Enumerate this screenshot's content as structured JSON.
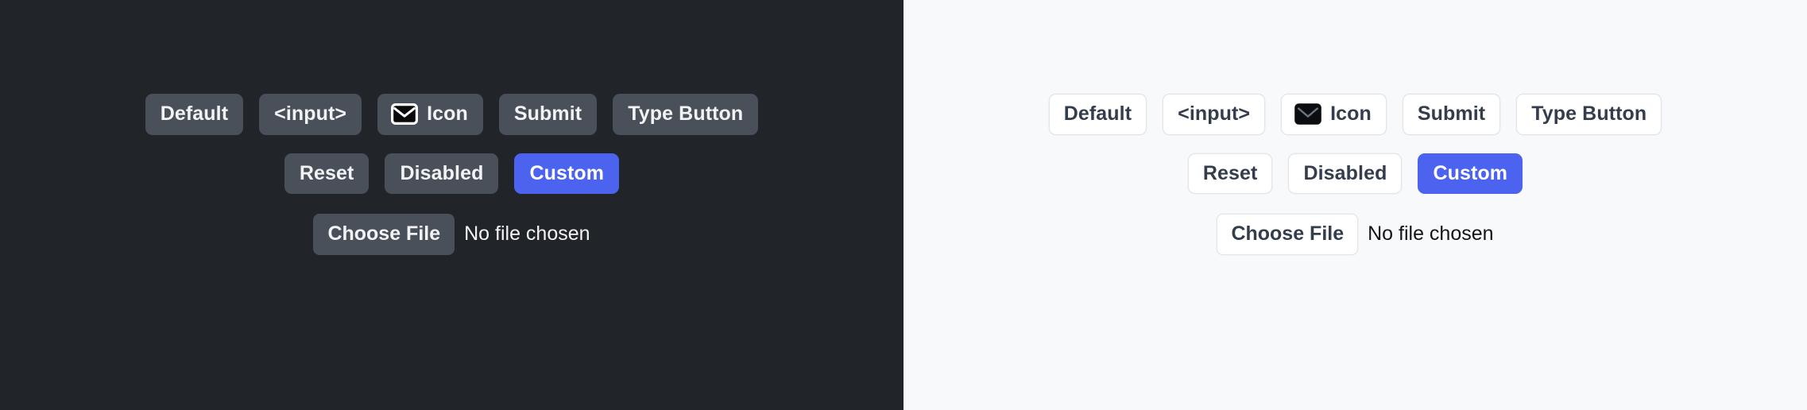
{
  "panels": [
    {
      "theme": "dark",
      "background": "#212428",
      "button_bg": "#4a505a",
      "button_text": "#f1f3f5",
      "accent": "#4c63f0",
      "rows": {
        "row1": [
          {
            "label": "Default",
            "name": "default-button"
          },
          {
            "label": "<input>",
            "name": "input-button"
          },
          {
            "label": "Icon",
            "name": "icon-button",
            "icon": "envelope-icon"
          },
          {
            "label": "Submit",
            "name": "submit-button"
          },
          {
            "label": "Type Button",
            "name": "type-button"
          }
        ],
        "row2": [
          {
            "label": "Reset",
            "name": "reset-button"
          },
          {
            "label": "Disabled",
            "name": "disabled-button"
          },
          {
            "label": "Custom",
            "name": "custom-button",
            "variant": "custom"
          }
        ],
        "file": {
          "button_label": "Choose File",
          "status_text": "No file chosen"
        }
      }
    },
    {
      "theme": "light",
      "background": "#f8f9fb",
      "button_bg": "#ffffff",
      "button_text": "#343d4b",
      "button_border": "#e2e5ea",
      "accent": "#4c63f0",
      "rows": {
        "row1": [
          {
            "label": "Default",
            "name": "default-button"
          },
          {
            "label": "<input>",
            "name": "input-button"
          },
          {
            "label": "Icon",
            "name": "icon-button",
            "icon": "envelope-icon"
          },
          {
            "label": "Submit",
            "name": "submit-button"
          },
          {
            "label": "Type Button",
            "name": "type-button"
          }
        ],
        "row2": [
          {
            "label": "Reset",
            "name": "reset-button"
          },
          {
            "label": "Disabled",
            "name": "disabled-button"
          },
          {
            "label": "Custom",
            "name": "custom-button",
            "variant": "custom"
          }
        ],
        "file": {
          "button_label": "Choose File",
          "status_text": "No file chosen"
        }
      }
    }
  ]
}
